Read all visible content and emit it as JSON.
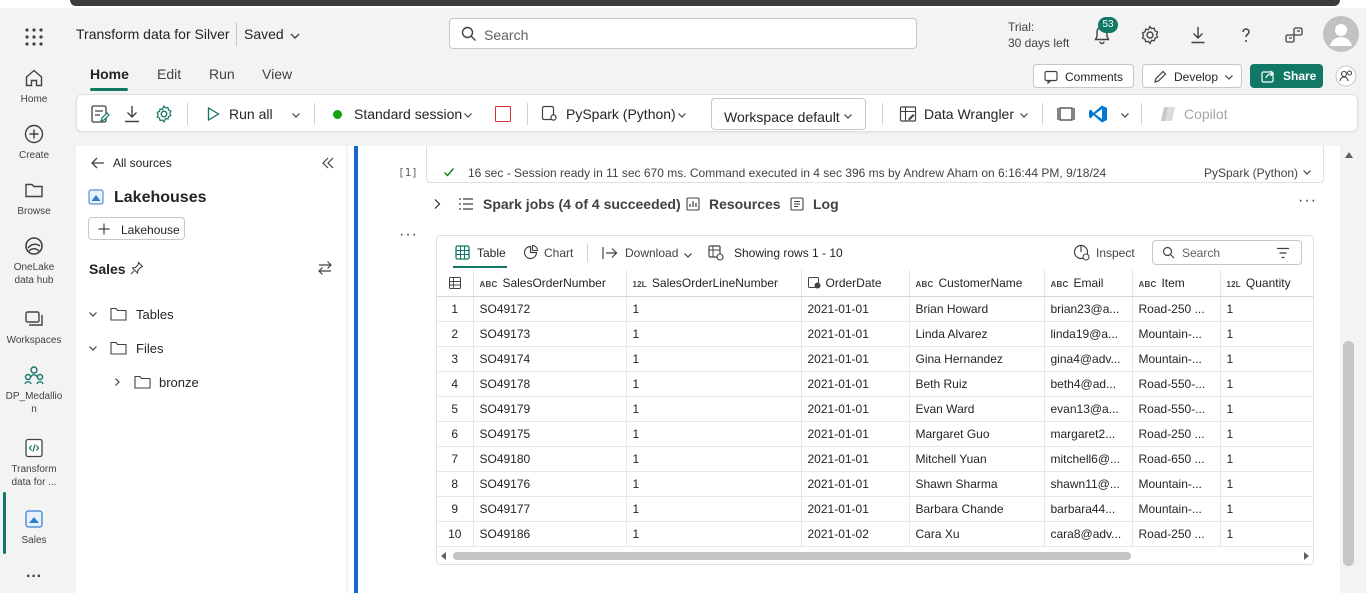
{
  "app": {
    "title": "Transform data for Silver",
    "status": "Saved"
  },
  "search": {
    "placeholder": "Search"
  },
  "trial": {
    "line1": "Trial:",
    "line2": "30 days left"
  },
  "notifications": {
    "count": "53"
  },
  "rail": [
    {
      "label": "Home",
      "icon": "home-icon"
    },
    {
      "label": "Create",
      "icon": "create-icon"
    },
    {
      "label": "Browse",
      "icon": "browse-icon"
    },
    {
      "label": "OneLake data hub",
      "icon": "onelake-icon"
    },
    {
      "label": "Workspaces",
      "icon": "workspaces-icon"
    },
    {
      "label": "DP_Medallion",
      "icon": "medallion-icon"
    },
    {
      "label": "Transform data for ...",
      "icon": "notebook-icon"
    },
    {
      "label": "Sales",
      "icon": "lakehouse-icon"
    }
  ],
  "tabs": [
    "Home",
    "Edit",
    "Run",
    "View"
  ],
  "ribbon_right": {
    "comments": "Comments",
    "develop": "Develop",
    "share": "Share"
  },
  "toolbar": {
    "run_all": "Run all",
    "session": "Standard session",
    "language": "PySpark (Python)",
    "environment": "Workspace default",
    "data_wrangler": "Data Wrangler",
    "copilot": "Copilot"
  },
  "explorer": {
    "back": "All sources",
    "heading": "Lakehouses",
    "add_button": "Lakehouse",
    "lakehouse": "Sales",
    "tree": [
      "Tables",
      "Files",
      "bronze"
    ]
  },
  "cell": {
    "exec_count": "[1]",
    "status": "16 sec - Session ready in 11 sec 670 ms. Command executed in 4 sec 396 ms by Andrew Aham on 6:16:44 PM, 9/18/24",
    "language": "PySpark (Python)",
    "spark_jobs": "Spark jobs (4 of 4 succeeded)",
    "resources": "Resources",
    "log": "Log"
  },
  "grid": {
    "view_table": "Table",
    "view_chart": "Chart",
    "download": "Download",
    "showing": "Showing rows 1 - 10",
    "inspect": "Inspect",
    "search_placeholder": "Search",
    "columns": [
      {
        "type": "ABC",
        "name": "SalesOrderNumber"
      },
      {
        "type": "12L",
        "name": "SalesOrderLineNumber"
      },
      {
        "type": "date",
        "name": "OrderDate"
      },
      {
        "type": "ABC",
        "name": "CustomerName"
      },
      {
        "type": "ABC",
        "name": "Email"
      },
      {
        "type": "ABC",
        "name": "Item"
      },
      {
        "type": "12L",
        "name": "Quantity"
      }
    ],
    "rows": [
      [
        "1",
        "SO49172",
        "1",
        "2021-01-01",
        "Brian Howard",
        "brian23@a...",
        "Road-250 ...",
        "1"
      ],
      [
        "2",
        "SO49173",
        "1",
        "2021-01-01",
        "Linda Alvarez",
        "linda19@a...",
        "Mountain-...",
        "1"
      ],
      [
        "3",
        "SO49174",
        "1",
        "2021-01-01",
        "Gina Hernandez",
        "gina4@adv...",
        "Mountain-...",
        "1"
      ],
      [
        "4",
        "SO49178",
        "1",
        "2021-01-01",
        "Beth Ruiz",
        "beth4@ad...",
        "Road-550-...",
        "1"
      ],
      [
        "5",
        "SO49179",
        "1",
        "2021-01-01",
        "Evan Ward",
        "evan13@a...",
        "Road-550-...",
        "1"
      ],
      [
        "6",
        "SO49175",
        "1",
        "2021-01-01",
        "Margaret Guo",
        "margaret2...",
        "Road-250 ...",
        "1"
      ],
      [
        "7",
        "SO49180",
        "1",
        "2021-01-01",
        "Mitchell Yuan",
        "mitchell6@...",
        "Road-650 ...",
        "1"
      ],
      [
        "8",
        "SO49176",
        "1",
        "2021-01-01",
        "Shawn Sharma",
        "shawn11@...",
        "Mountain-...",
        "1"
      ],
      [
        "9",
        "SO49177",
        "1",
        "2021-01-01",
        "Barbara Chande",
        "barbara44...",
        "Mountain-...",
        "1"
      ],
      [
        "10",
        "SO49186",
        "1",
        "2021-01-02",
        "Cara Xu",
        "cara8@adv...",
        "Road-250 ...",
        "1"
      ]
    ]
  },
  "colors": {
    "accent": "#117865",
    "cell_bar": "#1a66d1",
    "success": "#107c10",
    "session_dot": "#13a10e",
    "stop": "#d13438",
    "vscode": "#0078d4"
  }
}
